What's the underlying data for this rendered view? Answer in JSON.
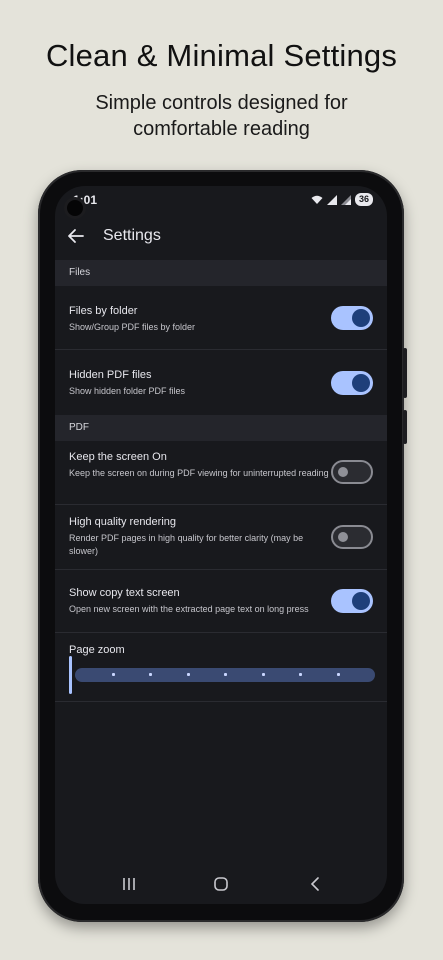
{
  "promo": {
    "headline": "Clean & Minimal Settings",
    "subline": "Simple controls designed for comfortable reading"
  },
  "status_bar": {
    "time": "1:01",
    "battery": "36"
  },
  "app_bar": {
    "title": "Settings",
    "back_icon": "arrow-left-icon"
  },
  "sections": [
    {
      "header": "Files",
      "items": [
        {
          "title": "Files by folder",
          "description": "Show/Group PDF files by folder",
          "enabled": true
        },
        {
          "title": "Hidden PDF files",
          "description": "Show hidden folder PDF files",
          "enabled": true
        }
      ]
    },
    {
      "header": "PDF",
      "items": [
        {
          "title": "Keep the screen On",
          "description": "Keep the screen on during PDF viewing for uninterrupted reading",
          "enabled": false
        },
        {
          "title": "High quality rendering",
          "description": "Render PDF pages in high quality for better clarity (may be slower)",
          "enabled": false
        },
        {
          "title": "Show copy text screen",
          "description": "Open new screen with the extracted page text on long press",
          "enabled": true
        }
      ]
    }
  ],
  "page_zoom": {
    "label": "Page zoom",
    "value_fraction": 0.0,
    "steps": 8
  },
  "nav_bar": {
    "recents_icon": "recents-icon",
    "home_icon": "home-icon",
    "back_icon": "back-chevron-icon"
  },
  "colors": {
    "accent": "#a9c3ff",
    "switch_knob_on": "#1e3f7a",
    "background": "#18191d",
    "promo_bg": "#e4e3da"
  }
}
